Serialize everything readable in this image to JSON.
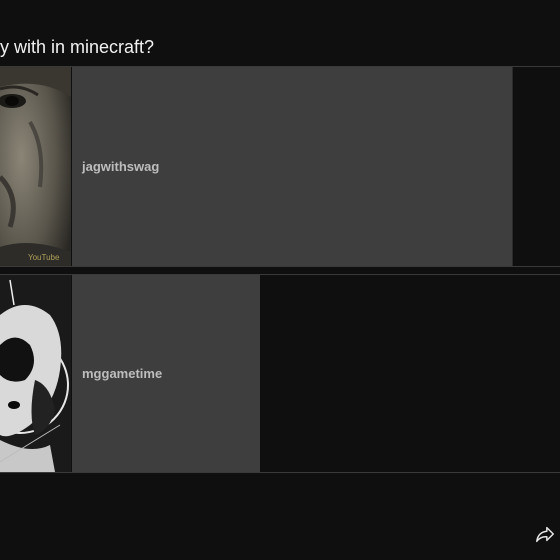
{
  "poll": {
    "question": "y with in minecraft?",
    "options": [
      {
        "label": "jagwithswag",
        "vote_fraction": 0.914,
        "thumbnail_watermark": "YouTube"
      },
      {
        "label": "mggametime",
        "vote_fraction": 0.39
      }
    ]
  },
  "actions": {
    "share_icon": "share-icon"
  },
  "colors": {
    "background": "#0f0f0f",
    "result_fill": "#3e3e3e",
    "label_text": "#bdbdbd",
    "question_text": "#f1f1f1"
  }
}
